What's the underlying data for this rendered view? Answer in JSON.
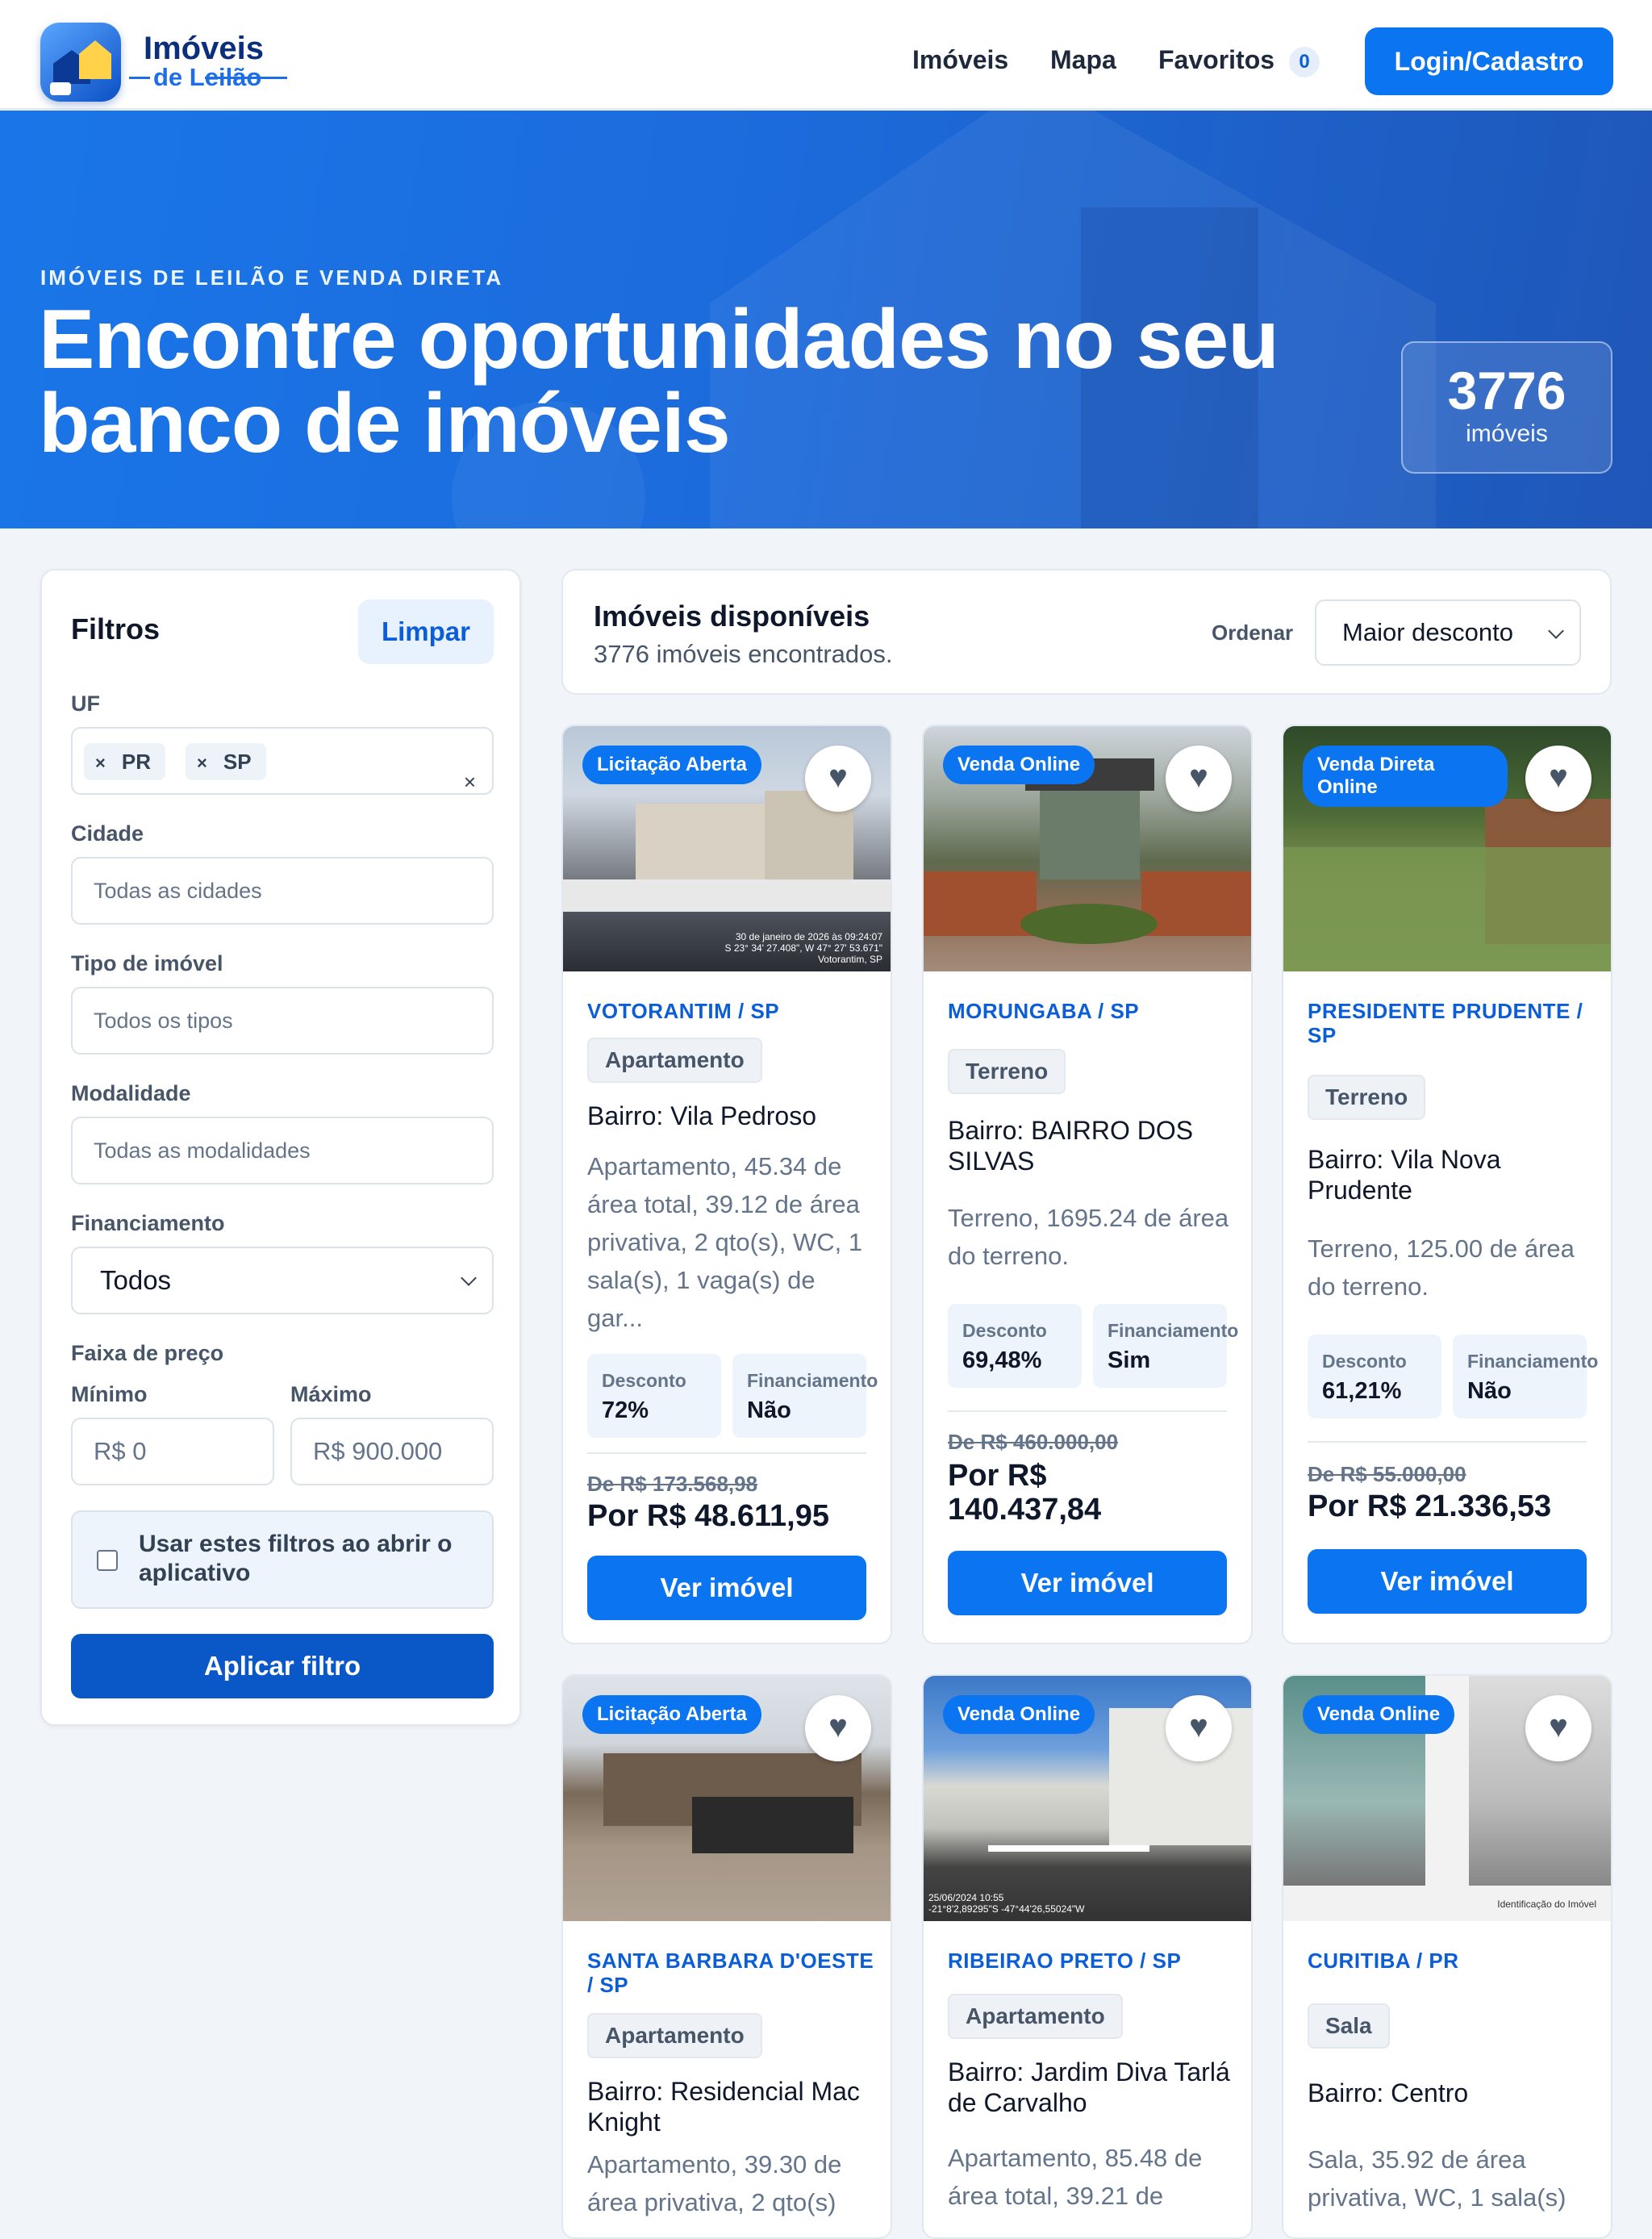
{
  "header": {
    "brand_line1": "Imóveis",
    "brand_line2": "de Leilão",
    "nav": [
      "Imóveis",
      "Mapa",
      "Favoritos"
    ],
    "favorites_count": "0",
    "login_label": "Login/Cadastro"
  },
  "hero": {
    "eyebrow": "IMÓVEIS DE LEILÃO E VENDA DIRETA",
    "title": "Encontre oportunidades no seu banco de imóveis",
    "count": "3776",
    "count_label": "imóveis"
  },
  "filters": {
    "title": "Filtros",
    "clear_label": "Limpar",
    "uf_label": "UF",
    "uf_chips": [
      "PR",
      "SP"
    ],
    "chip_remove_glyph": "×",
    "cidade_label": "Cidade",
    "cidade_placeholder": "Todas as cidades",
    "tipo_label": "Tipo de imóvel",
    "tipo_placeholder": "Todos os tipos",
    "modalidade_label": "Modalidade",
    "modalidade_placeholder": "Todas as modalidades",
    "financiamento_label": "Financiamento",
    "financiamento_value": "Todos",
    "faixa_label": "Faixa de preço",
    "min_label": "Mínimo",
    "max_label": "Máximo",
    "min_placeholder": "R$ 0",
    "max_placeholder": "R$ 900.000",
    "remember_label": "Usar estes filtros ao abrir o aplicativo",
    "apply_label": "Aplicar filtro"
  },
  "results": {
    "title": "Imóveis disponíveis",
    "subtitle": "3776 imóveis encontrados.",
    "sort_label": "Ordenar",
    "sort_value": "Maior desconto"
  },
  "labels": {
    "discount": "Desconto",
    "financing": "Financiamento",
    "cta": "Ver imóvel"
  },
  "listings": [
    {
      "badge": "Licitação Aberta",
      "city": "VOTORANTIM / SP",
      "type": "Apartamento",
      "bairro": "Bairro: Vila Pedroso",
      "desc": "Apartamento, 45.34 de área total, 39.12 de área privativa, 2 qto(s), WC, 1 sala(s), 1 vaga(s) de gar...",
      "discount": "72%",
      "financing": "Não",
      "old_price": "De R$ 173.568,98",
      "new_price": "Por R$ 48.611,95",
      "stamp": "30 de janeiro de 2026 às 09:24:07\nS 23° 34' 27.408\", W 47° 27' 53.671\"\nVotorantim, SP"
    },
    {
      "badge": "Venda Online",
      "city": "MORUNGABA / SP",
      "type": "Terreno",
      "bairro": "Bairro: BAIRRO DOS SILVAS",
      "desc": "Terreno, 1695.24 de área do terreno.",
      "discount": "69,48%",
      "financing": "Sim",
      "old_price": "De R$ 460.000,00",
      "new_price": "Por R$ 140.437,84",
      "stamp": ""
    },
    {
      "badge": "Venda Direta Online",
      "city": "PRESIDENTE PRUDENTE / SP",
      "type": "Terreno",
      "bairro": "Bairro: Vila Nova Prudente",
      "desc": "Terreno, 125.00 de área do terreno.",
      "discount": "61,21%",
      "financing": "Não",
      "old_price": "De R$ 55.000,00",
      "new_price": "Por R$ 21.336,53",
      "stamp": ""
    },
    {
      "badge": "Licitação Aberta",
      "city": "SANTA BARBARA D'OESTE / SP",
      "type": "Apartamento",
      "bairro": "Bairro: Residencial Mac Knight",
      "desc": "Apartamento, 39.30 de área privativa, 2 qto(s)",
      "stamp": ""
    },
    {
      "badge": "Venda Online",
      "city": "RIBEIRAO PRETO / SP",
      "type": "Apartamento",
      "bairro": "Bairro: Jardim Diva Tarlá de Carvalho",
      "desc": "Apartamento, 85.48 de área total, 39.21 de",
      "stamp": "25/06/2024 10:55\n-21°8'2,89295\"S -47°44'26,55024\"W"
    },
    {
      "badge": "Venda Online",
      "city": "CURITIBA / PR",
      "type": "Sala",
      "bairro": "Bairro: Centro",
      "desc": "Sala, 35.92 de área privativa, WC, 1 sala(s)",
      "stamp": "Identificação do Imóvel"
    }
  ]
}
